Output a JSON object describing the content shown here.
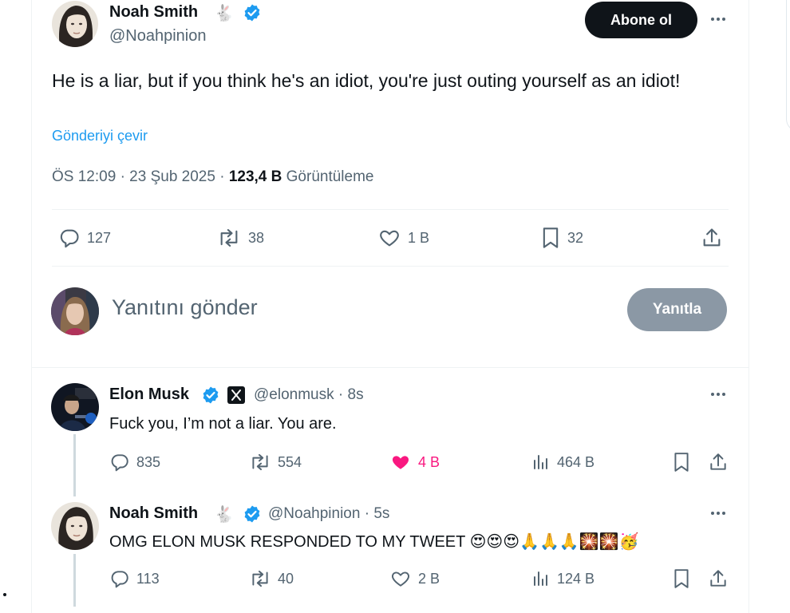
{
  "main_post": {
    "author_name": "Noah Smith",
    "name_emoji": "🐇",
    "handle": "@Noahpinion",
    "follow_label": "Abone ol",
    "text": "He is a liar, but if you think he's an idiot, you're just outing yourself as an idiot!",
    "translate_label": "Gönderiyi çevir",
    "time": "ÖS 12:09",
    "date": "23 Şub 2025",
    "views_count": "123,4 B",
    "views_label": "Görüntüleme",
    "stats": {
      "replies": "127",
      "reposts": "38",
      "likes": "1 B",
      "bookmarks": "32"
    }
  },
  "composer": {
    "placeholder": "Yanıtını gönder",
    "submit_label": "Yanıtla"
  },
  "replies": [
    {
      "author_name": "Elon Musk",
      "handle": "@elonmusk",
      "time": "8s",
      "text": "Fuck you, I’m not a liar. You are.",
      "stats": {
        "replies": "835",
        "reposts": "554",
        "likes": "4 B",
        "views": "464 B"
      },
      "liked": true
    },
    {
      "author_name": "Noah Smith",
      "name_emoji": "🐇",
      "handle": "@Noahpinion",
      "time": "5s",
      "text": "OMG ELON MUSK RESPONDED TO MY TWEET",
      "emojis": "😍😍😍🙏🙏🙏🎇🎇🥳",
      "stats": {
        "replies": "113",
        "reposts": "40",
        "likes": "2 B",
        "views": "124 B"
      },
      "liked": false
    }
  ],
  "colors": {
    "accent": "#1d9bf0",
    "like_active": "#f91880",
    "text_primary": "#0f1419",
    "text_secondary": "#536471",
    "verified": "#1d9bf0",
    "disabled_button": "#8b98a5"
  }
}
